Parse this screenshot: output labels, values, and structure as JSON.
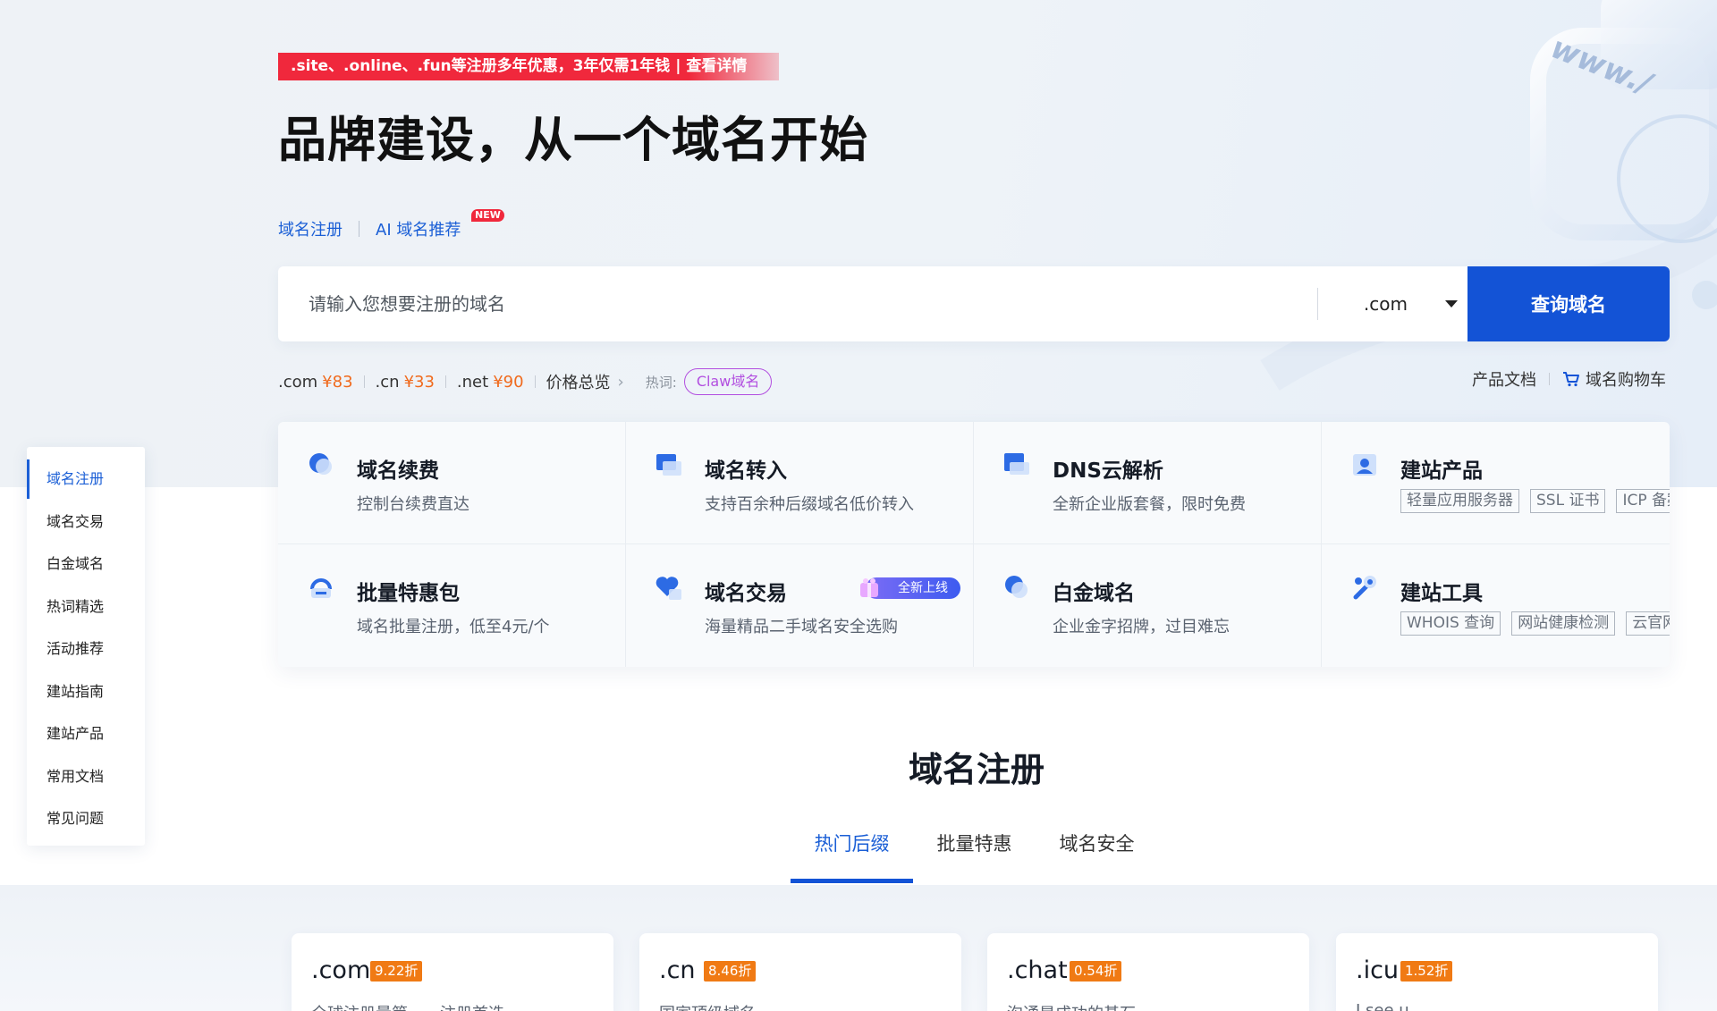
{
  "promo": {
    "text": ".site、.online、.fun等注册多年优惠，3年仅需1年钱 | 查看详情"
  },
  "hero": {
    "title": "品牌建设，从一个域名开始"
  },
  "modes": {
    "register": "域名注册",
    "ai": "AI 域名推荐",
    "new_badge": "NEW"
  },
  "search": {
    "placeholder": "请输入您想要注册的域名",
    "tld": ".com",
    "button": "查询域名"
  },
  "prices": [
    {
      "tld": ".com",
      "price": "¥83"
    },
    {
      "tld": ".cn",
      "price": "¥33"
    },
    {
      "tld": ".net",
      "price": "¥90"
    }
  ],
  "price_overview": "价格总览",
  "hot": {
    "label": "热词:",
    "tag": "Claw域名"
  },
  "links": {
    "docs": "产品文档",
    "cart": "域名购物车"
  },
  "features": [
    {
      "title": "域名续费",
      "desc": "控制台续费直达"
    },
    {
      "title": "域名转入",
      "desc": "支持百余种后缀域名低价转入"
    },
    {
      "title": "DNS云解析",
      "desc": "全新企业版套餐，限时免费"
    },
    {
      "title": "建站产品",
      "tags": [
        "轻量应用服务器",
        "SSL 证书",
        "ICP 备案"
      ]
    },
    {
      "title": "批量特惠包",
      "desc": "域名批量注册，低至4元/个"
    },
    {
      "title": "域名交易",
      "desc": "海量精品二手域名安全选购",
      "badge": "全新上线"
    },
    {
      "title": "白金域名",
      "desc": "企业金字招牌，过目难忘"
    },
    {
      "title": "建站工具",
      "tags": [
        "WHOIS 查询",
        "网站健康检测",
        "云官网建站"
      ]
    }
  ],
  "side_nav": [
    "域名注册",
    "域名交易",
    "白金域名",
    "热词精选",
    "活动推荐",
    "建站指南",
    "建站产品",
    "常用文档",
    "常见问题"
  ],
  "section": {
    "title": "域名注册",
    "tabs": [
      "热门后缀",
      "批量特惠",
      "域名安全"
    ]
  },
  "cards": [
    {
      "tld": ".com",
      "discount": "9.22折",
      "desc": "全球注册量第一，注册首选"
    },
    {
      "tld": ".cn",
      "discount": "8.46折",
      "desc": "国家顶级域名"
    },
    {
      "tld": ".chat",
      "discount": "0.54折",
      "desc": "沟通是成功的基石"
    },
    {
      "tld": ".icu",
      "discount": "1.52折",
      "desc": "I see u"
    }
  ],
  "colors": {
    "brand": "#1353d6",
    "promo": "#f0283c",
    "price": "#f06a1d",
    "hot": "#b24fe0",
    "discount": "#f07a14"
  }
}
